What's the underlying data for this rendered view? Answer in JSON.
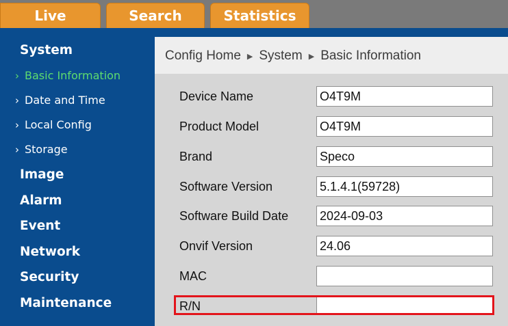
{
  "tabs": [
    {
      "label": "Live"
    },
    {
      "label": "Search"
    },
    {
      "label": "Statistics"
    }
  ],
  "sidebar": {
    "system": "System",
    "system_items": [
      {
        "label": "Basic Information",
        "active": true
      },
      {
        "label": "Date and Time"
      },
      {
        "label": "Local Config"
      },
      {
        "label": "Storage"
      }
    ],
    "sections": [
      "Image",
      "Alarm",
      "Event",
      "Network",
      "Security",
      "Maintenance"
    ]
  },
  "breadcrumb": [
    "Config Home",
    "System",
    "Basic Information"
  ],
  "form": [
    {
      "label": "Device Name",
      "value": "O4T9M"
    },
    {
      "label": "Product Model",
      "value": "O4T9M"
    },
    {
      "label": "Brand",
      "value": "Speco"
    },
    {
      "label": "Software Version",
      "value": "5.1.4.1(59728)"
    },
    {
      "label": "Software Build Date",
      "value": "2024-09-03"
    },
    {
      "label": "Onvif Version",
      "value": "24.06"
    },
    {
      "label": "MAC",
      "value": ""
    },
    {
      "label": "R/N",
      "value": ""
    }
  ],
  "icons": {
    "chevron": "chevron-right-icon",
    "crumb_separator": "triangle-right-icon"
  },
  "colors": {
    "sidebar_bg": "#0a4c8e",
    "tab_bg": "#e8962e",
    "active_item": "#5edc6e",
    "highlight": "#e3141b",
    "content_bg": "#d6d6d6"
  }
}
